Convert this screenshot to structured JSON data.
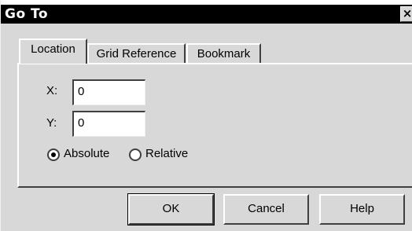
{
  "window": {
    "title": "Go To",
    "close_glyph": "×"
  },
  "tabs": [
    {
      "label": "Location",
      "active": true
    },
    {
      "label": "Grid Reference",
      "active": false
    },
    {
      "label": "Bookmark",
      "active": false
    }
  ],
  "location": {
    "x": {
      "label": "X:",
      "value": "0"
    },
    "y": {
      "label": "Y:",
      "value": "0"
    },
    "mode": {
      "options": [
        "Absolute",
        "Relative"
      ],
      "selected": "Absolute"
    }
  },
  "buttons": {
    "ok": "OK",
    "cancel": "Cancel",
    "help": "Help"
  }
}
